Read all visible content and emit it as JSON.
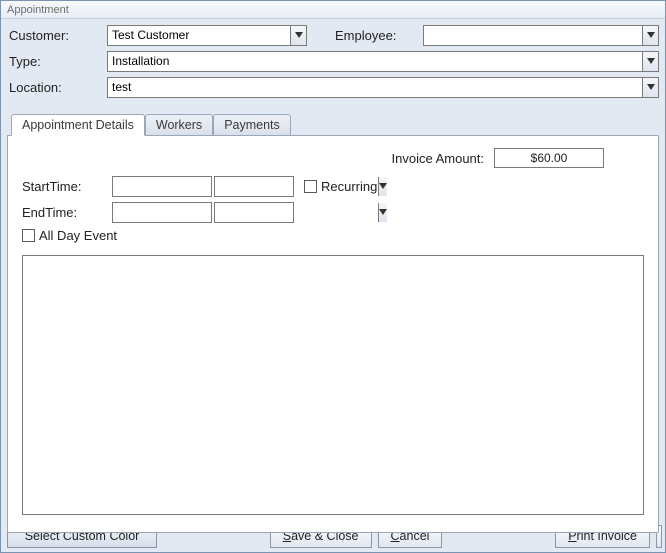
{
  "window": {
    "title": "Appointment"
  },
  "header": {
    "customer_label": "Customer:",
    "customer_value": "Test Customer",
    "employee_label": "Employee:",
    "employee_value": "",
    "type_label": "Type:",
    "type_value": "Installation",
    "location_label": "Location:",
    "location_value": "test"
  },
  "tabs": {
    "details": "Appointment Details",
    "workers": "Workers",
    "payments": "Payments"
  },
  "details": {
    "invoice_label": "Invoice Amount:",
    "invoice_value": "$60.00",
    "starttime_label": "StartTime:",
    "starttime_date": "",
    "starttime_time": "",
    "endtime_label": "EndTime:",
    "endtime_date": "",
    "endtime_time": "",
    "recurring_label": "Recurring",
    "allday_label": "All Day Event"
  },
  "footer": {
    "select_color": "Select Custom Color",
    "save_close_prefix": "S",
    "save_close_rest": "ave & Close",
    "cancel_prefix": "C",
    "cancel_rest": "ancel",
    "print_prefix": "P",
    "print_rest": "rint Invoice"
  }
}
